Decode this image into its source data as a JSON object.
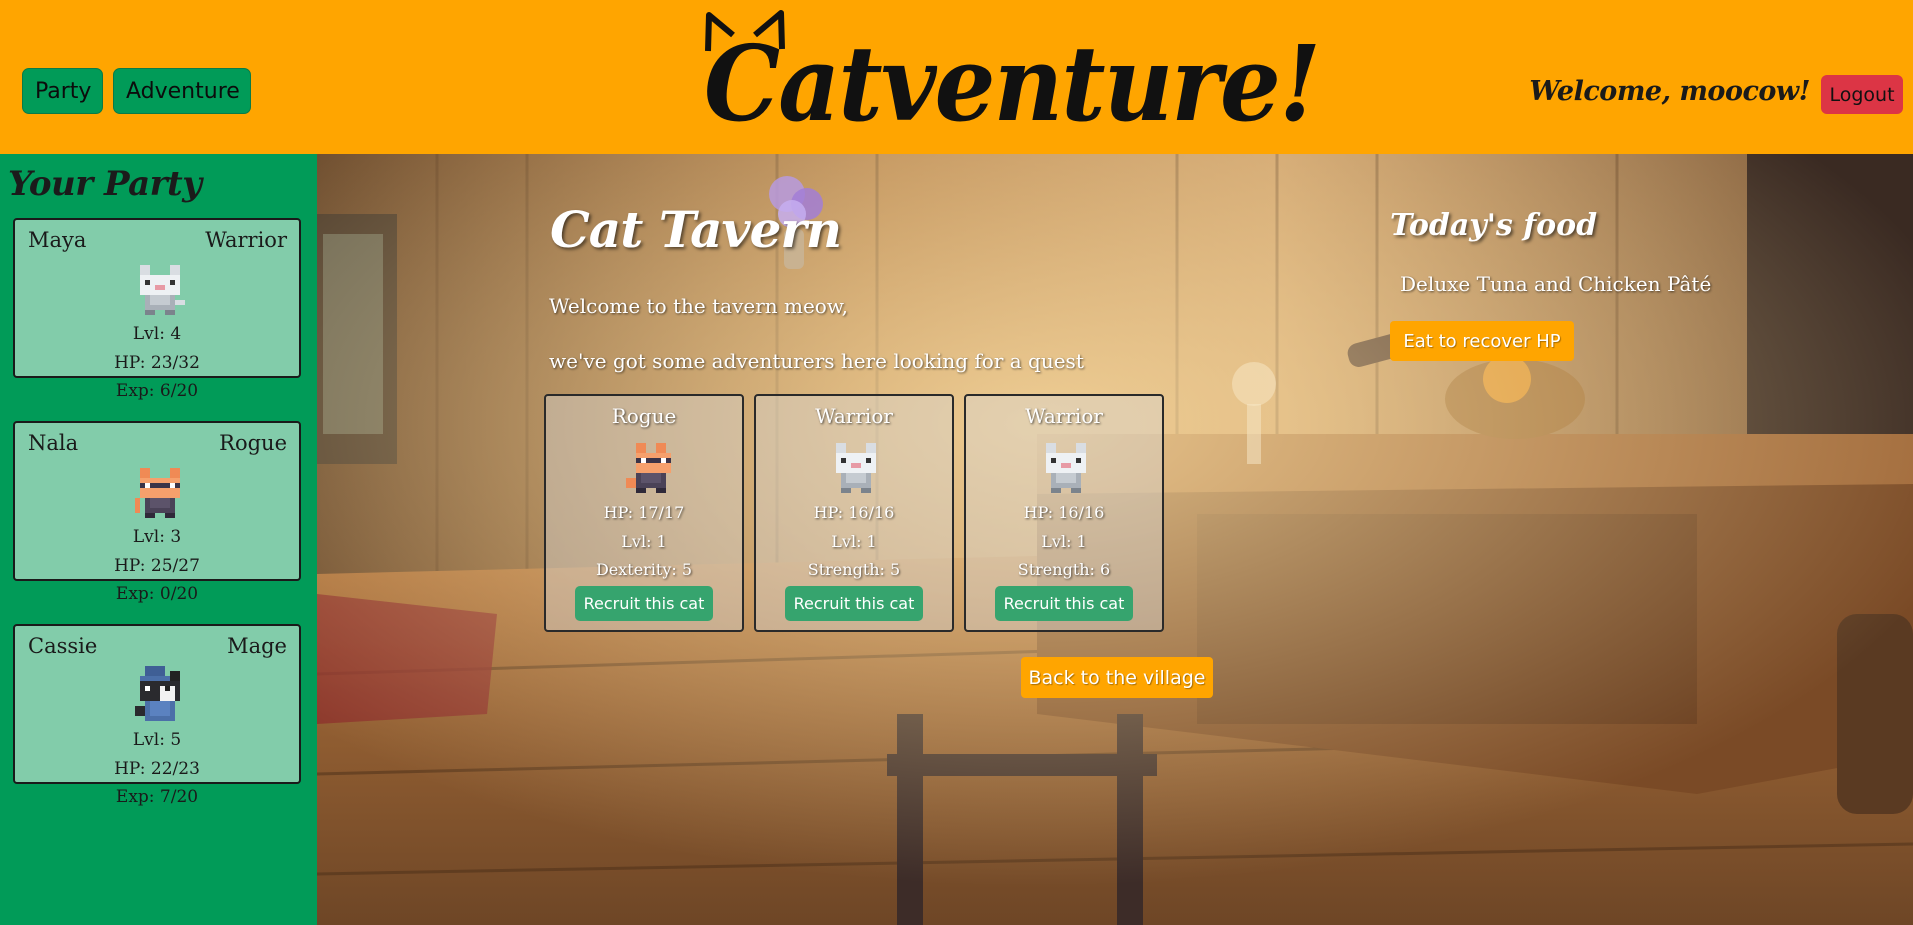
{
  "header": {
    "nav": {
      "party_label": "Party",
      "adventure_label": "Adventure"
    },
    "logo_text": "Catventure!",
    "welcome_text": "Welcome, moocow!",
    "logout_label": "Logout"
  },
  "sidebar": {
    "title": "Your Party",
    "members": [
      {
        "name": "Maya",
        "class": "Warrior",
        "level": "Lvl: 4",
        "hp": "HP: 23/32",
        "exp": "Exp: 6/20",
        "sprite": "white-warrior-cat-icon"
      },
      {
        "name": "Nala",
        "class": "Rogue",
        "level": "Lvl: 3",
        "hp": "HP: 25/27",
        "exp": "Exp: 0/20",
        "sprite": "orange-rogue-cat-icon"
      },
      {
        "name": "Cassie",
        "class": "Mage",
        "level": "Lvl: 5",
        "hp": "HP: 22/23",
        "exp": "Exp: 7/20",
        "sprite": "black-mage-cat-icon"
      }
    ]
  },
  "tavern": {
    "title": "Cat Tavern",
    "intro_line1": "Welcome to the tavern meow,",
    "intro_line2": "we've got some adventurers here looking for a quest",
    "recruits": [
      {
        "class": "Rogue",
        "hp": "HP: 17/17",
        "level": "Lvl: 1",
        "stat": "Dexterity: 5",
        "button": "Recruit this cat",
        "sprite": "orange-rogue-cat-icon"
      },
      {
        "class": "Warrior",
        "hp": "HP: 16/16",
        "level": "Lvl: 1",
        "stat": "Strength: 5",
        "button": "Recruit this cat",
        "sprite": "white-warrior-cat-icon"
      },
      {
        "class": "Warrior",
        "hp": "HP: 16/16",
        "level": "Lvl: 1",
        "stat": "Strength: 6",
        "button": "Recruit this cat",
        "sprite": "white-warrior-cat-icon"
      }
    ],
    "back_label": "Back to the village"
  },
  "food": {
    "title": "Today's food",
    "name": "Deluxe Tuna and Chicken Pâté",
    "eat_label": "Eat to recover HP"
  },
  "colors": {
    "header_bg": "#ffa500",
    "sidebar_bg": "#019b58",
    "card_bg": "#82ccaa",
    "logout_bg": "#dc3545",
    "recruit_button_bg": "#36a46e"
  }
}
